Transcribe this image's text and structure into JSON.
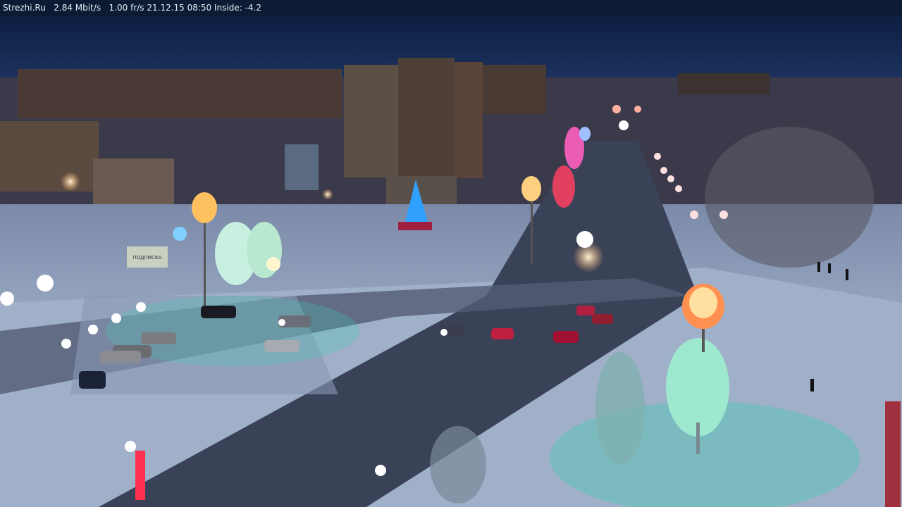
{
  "overlay": {
    "text": "Strezhi.Ru   2.84 Mbit/s   1.00 fr/s 21.12.15 08:50 Inside: -4.2"
  },
  "billboard": {
    "text": "ПОДПИСКА"
  },
  "colors": {
    "sky": "#0f2347",
    "snow": "#dfe7f3",
    "road": "#2a3347",
    "lamp": "#ffe0b0"
  }
}
